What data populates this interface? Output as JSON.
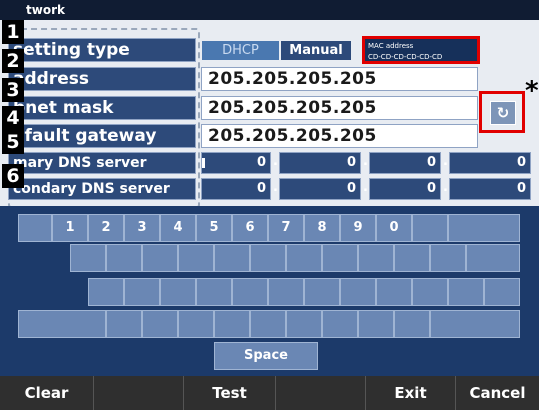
{
  "title": "twork",
  "rows": [
    {
      "badge": "1",
      "label": "setting type"
    },
    {
      "badge": "2",
      "label": "address",
      "value": "205.205.205.205"
    },
    {
      "badge": "3",
      "label": "bnet mask",
      "value": "205.205.205.205"
    },
    {
      "badge": "4",
      "label": "efault gateway",
      "value": "205.205.205.205"
    },
    {
      "badge": "5",
      "label": "mary DNS server"
    },
    {
      "badge": "6",
      "label": "condary DNS server"
    }
  ],
  "toggle": {
    "dhcp": "DHCP",
    "manual": "Manual",
    "selected": "Manual"
  },
  "mac": {
    "label": "MAC address",
    "value": "CD-CD-CD-CD-CD-CD"
  },
  "asterisk": "*",
  "reload_icon": "↻",
  "dns": {
    "primary": [
      "0",
      "0",
      "0",
      "0"
    ],
    "secondary": [
      "0",
      "0",
      "0",
      "0"
    ]
  },
  "dns_dot": ".",
  "keyboard": {
    "number_keys": [
      "1",
      "2",
      "3",
      "4",
      "5",
      "6",
      "7",
      "8",
      "9",
      "0"
    ],
    "space": "Space"
  },
  "bottom": {
    "clear": "Clear",
    "test": "Test",
    "exit": "Exit",
    "cancel": "Cancel"
  },
  "colors": {
    "background": "#16305a",
    "highlight": "#e10000",
    "key": "#6a87b4"
  }
}
